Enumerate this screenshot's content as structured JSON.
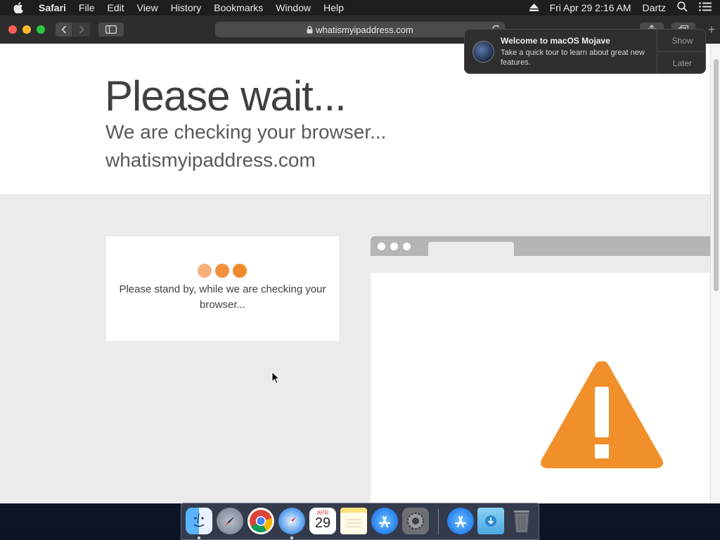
{
  "menubar": {
    "app_name": "Safari",
    "items": [
      "File",
      "Edit",
      "View",
      "History",
      "Bookmarks",
      "Window",
      "Help"
    ],
    "datetime": "Fri Apr 29  2:16 AM",
    "user": "Dartz"
  },
  "toolbar": {
    "url": "whatismyipaddress.com"
  },
  "page": {
    "title": "Please wait...",
    "subtitle": "We are checking your browser...",
    "domain": "whatismyipaddress.com",
    "standby_message": "Please stand by, while we are checking your browser...",
    "dot_colors": [
      "#f5b07c",
      "#f18f3a",
      "#ef8a2a"
    ],
    "warning_color": "#f18f2a"
  },
  "notification": {
    "title": "Welcome to macOS Mojave",
    "body": "Take a quick tour to learn about great new features.",
    "show_label": "Show",
    "later_label": "Later"
  },
  "dock": {
    "calendar_month": "APR",
    "calendar_day": "29"
  },
  "icons": [
    "apple-logo-icon",
    "eject-icon",
    "search-icon",
    "list-icon",
    "lock-icon",
    "reload-icon",
    "share-icon",
    "tabs-icon",
    "warning-icon"
  ]
}
